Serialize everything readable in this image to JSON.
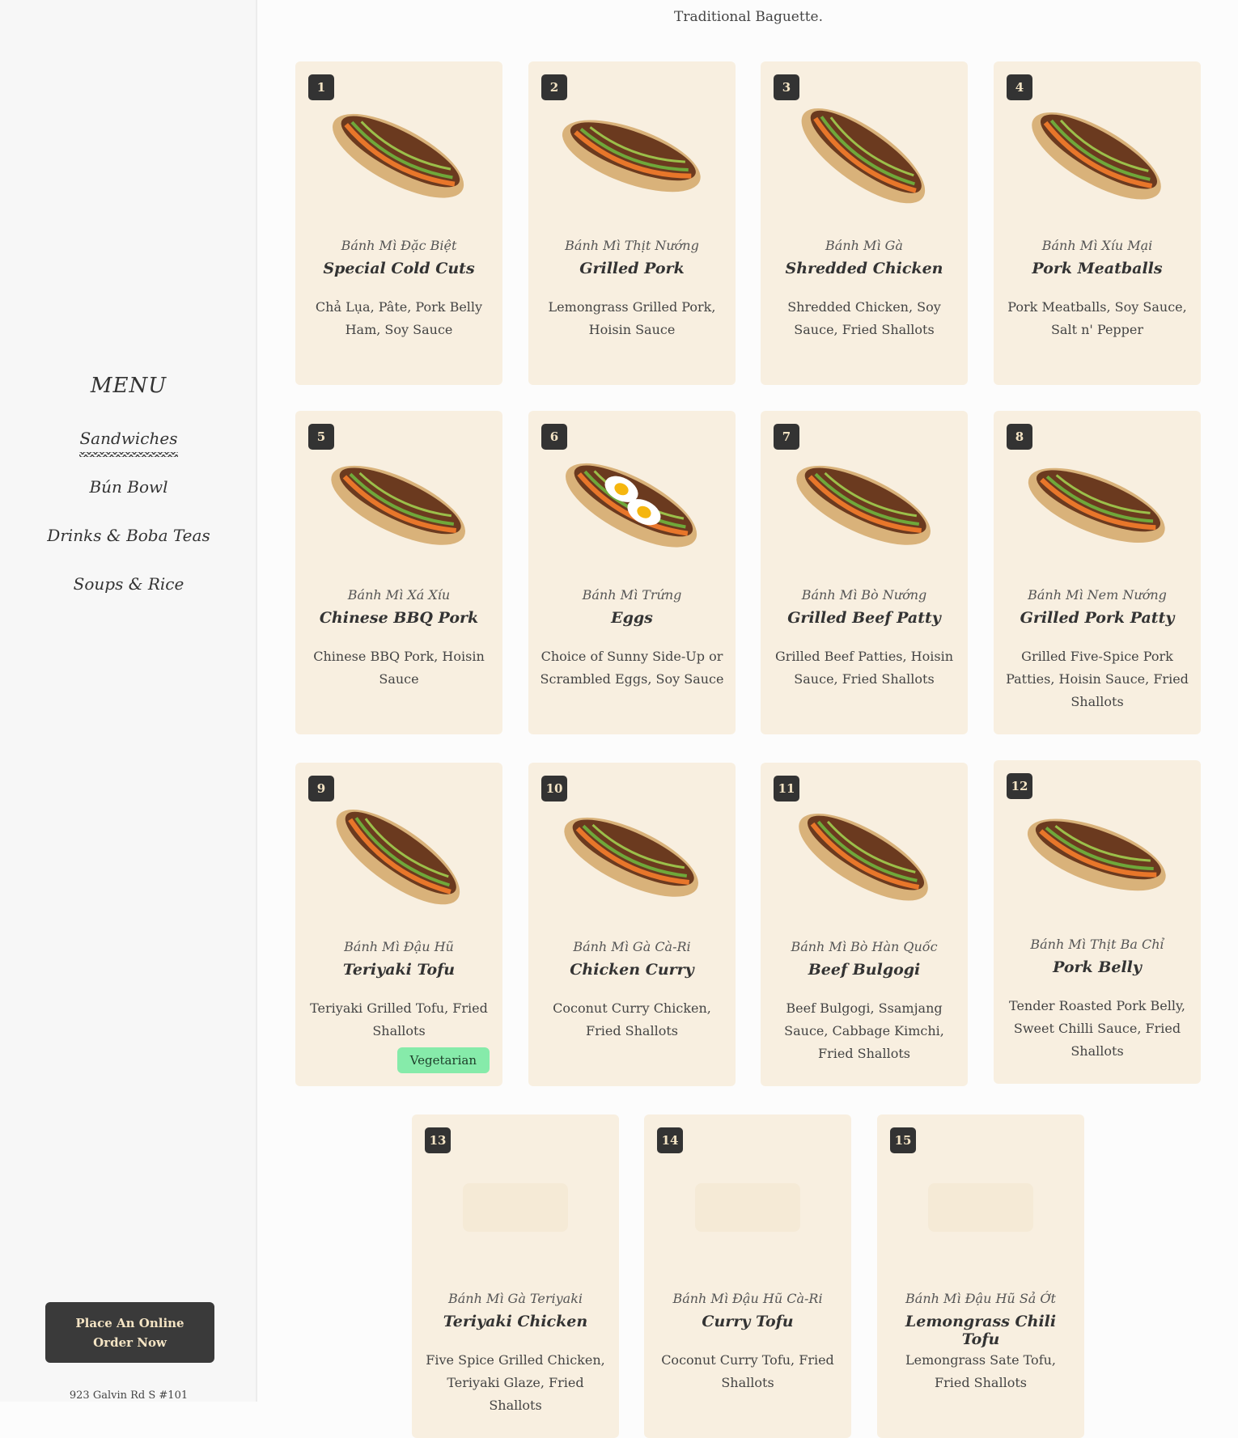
{
  "sidebar": {
    "menu_title": "MENU",
    "nav": [
      {
        "label": "Sandwiches",
        "active": true
      },
      {
        "label": "Bún Bowl",
        "active": false
      },
      {
        "label": "Drinks & Boba Teas",
        "active": false
      },
      {
        "label": "Soups & Rice",
        "active": false
      }
    ],
    "order_button": "Place An Online Order Now",
    "address": "923 Galvin Rd S #101"
  },
  "intro_text": "Traditional Baguette.",
  "colors": {
    "card_bg": "#f8efe0",
    "badge_bg": "#333333",
    "badge_text": "#f4e4c4",
    "vegetarian_tag": "#86ebaa",
    "order_button_bg": "#3a3a3a"
  },
  "items": [
    {
      "number": "1",
      "viet": "Bánh Mì Đặc Biệt",
      "name": "Special Cold Cuts",
      "description": "Chả Lụa, Pâte, Pork Belly Ham, Soy Sauce",
      "tag": "",
      "image": "sandwich-icon"
    },
    {
      "number": "2",
      "viet": "Bánh Mì Thịt Nướng",
      "name": "Grilled Pork",
      "description": "Lemongrass Grilled Pork, Hoisin Sauce",
      "tag": "",
      "image": "sandwich-icon"
    },
    {
      "number": "3",
      "viet": "Bánh Mì Gà",
      "name": "Shredded Chicken",
      "description": "Shredded Chicken, Soy Sauce, Fried Shallots",
      "tag": "",
      "image": "sandwich-icon"
    },
    {
      "number": "4",
      "viet": "Bánh Mì Xíu Mại",
      "name": "Pork Meatballs",
      "description": "Pork Meatballs, Soy Sauce, Salt n' Pepper",
      "tag": "",
      "image": "sandwich-icon"
    },
    {
      "number": "5",
      "viet": "Bánh Mì Xá Xíu",
      "name": "Chinese BBQ Pork",
      "description": "Chinese BBQ Pork, Hoisin Sauce",
      "tag": "",
      "image": "sandwich-icon"
    },
    {
      "number": "6",
      "viet": "Bánh Mì Trứng",
      "name": "Eggs",
      "description": "Choice of Sunny Side-Up or Scrambled Eggs, Soy Sauce",
      "tag": "",
      "image": "egg-sandwich-icon"
    },
    {
      "number": "7",
      "viet": "Bánh Mì Bò Nướng",
      "name": "Grilled Beef Patty",
      "description": "Grilled Beef Patties, Hoisin Sauce, Fried Shallots",
      "tag": "",
      "image": "sandwich-icon"
    },
    {
      "number": "8",
      "viet": "Bánh Mì Nem Nướng",
      "name": "Grilled Pork Patty",
      "description": "Grilled Five-Spice Pork Patties, Hoisin Sauce, Fried Shallots",
      "tag": "",
      "image": "sandwich-icon"
    },
    {
      "number": "9",
      "viet": "Bánh Mì Đậu Hũ",
      "name": "Teriyaki Tofu",
      "description": "Teriyaki Grilled Tofu, Fried Shallots",
      "tag": "Vegetarian",
      "image": "sandwich-icon"
    },
    {
      "number": "10",
      "viet": "Bánh Mì Gà Cà-Ri",
      "name": "Chicken Curry",
      "description": "Coconut Curry Chicken, Fried Shallots",
      "tag": "",
      "image": "sandwich-icon"
    },
    {
      "number": "11",
      "viet": "Bánh Mì Bò Hàn Quốc",
      "name": "Beef Bulgogi",
      "description": "Beef Bulgogi, Ssamjang Sauce, Cabbage Kimchi, Fried Shallots",
      "tag": "",
      "image": "sandwich-icon"
    },
    {
      "number": "12",
      "viet": "Bánh Mì Thịt Ba Chỉ",
      "name": "Pork Belly",
      "description": "Tender Roasted Pork Belly, Sweet Chilli Sauce, Fried Shallots",
      "tag": "",
      "image": "sandwich-icon"
    },
    {
      "number": "13",
      "viet": "Bánh Mì Gà Teriyaki",
      "name": "Teriyaki Chicken",
      "description": "Five Spice Grilled Chicken, Teriyaki Glaze, Fried Shallots",
      "tag": "",
      "image": "image-placeholder"
    },
    {
      "number": "14",
      "viet": "Bánh Mì Đậu Hũ Cà-Ri",
      "name": "Curry Tofu",
      "description": "Coconut Curry Tofu, Fried Shallots",
      "tag": "",
      "image": "image-placeholder"
    },
    {
      "number": "15",
      "viet": "Bánh Mì Đậu Hũ Sả Ớt",
      "name": "Lemongrass Chili Tofu",
      "description": "Lemongrass Sate Tofu, Fried Shallots",
      "tag": "",
      "image": "image-placeholder"
    }
  ]
}
